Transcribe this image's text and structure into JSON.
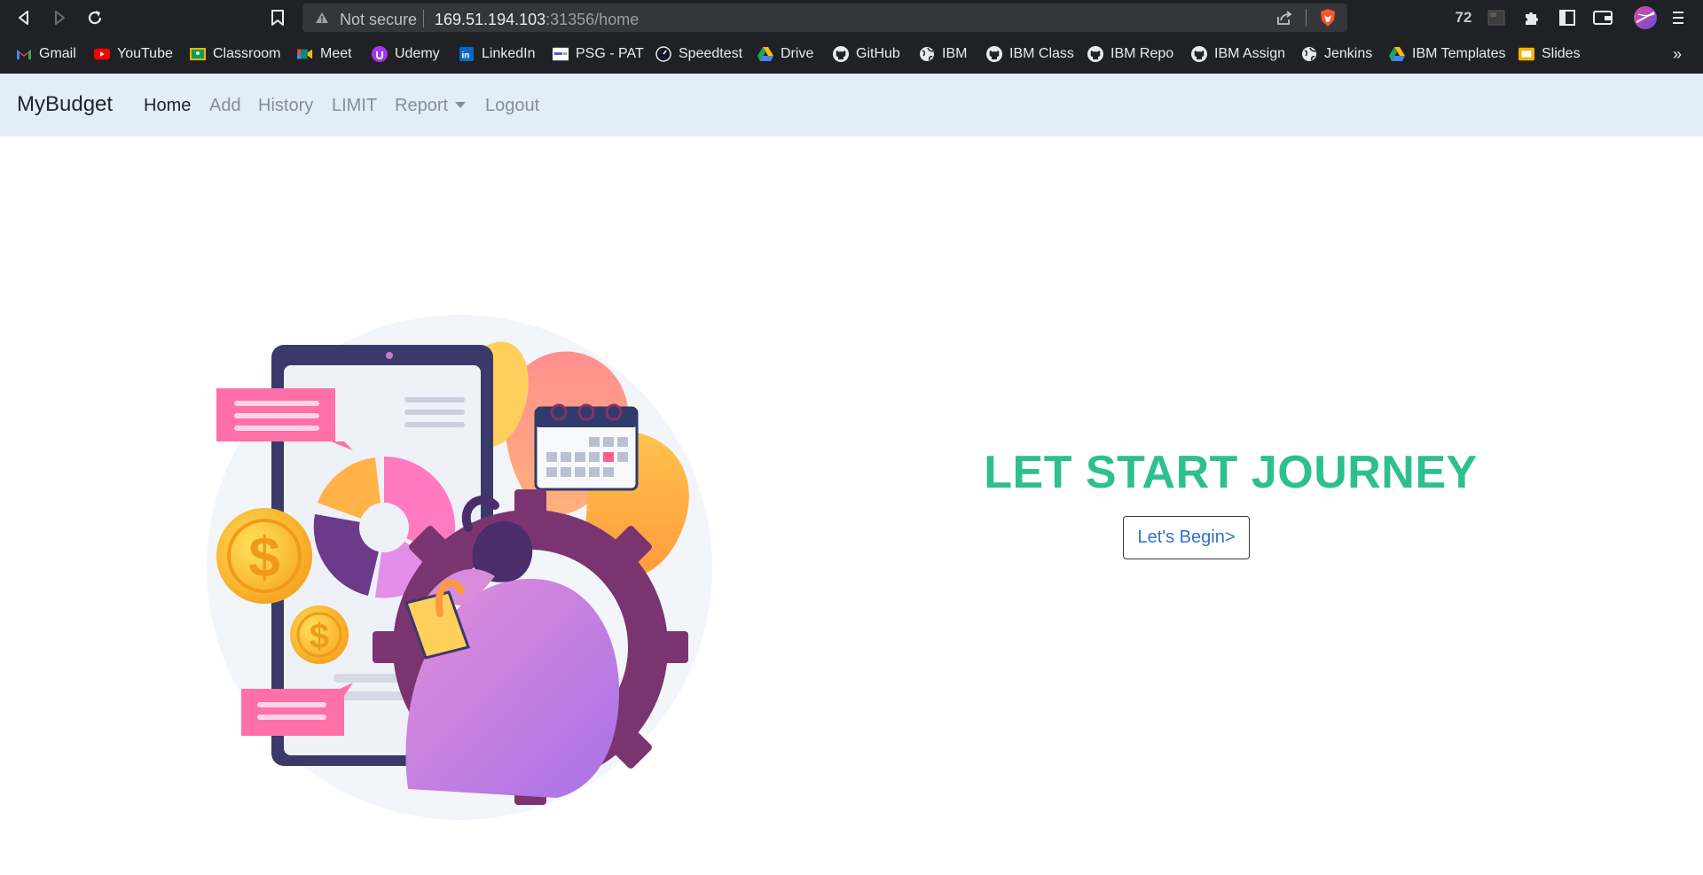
{
  "browser": {
    "security_label": "Not secure",
    "url_host": "169.51.194.103",
    "url_rest": ":31356/home",
    "ext_badge": "72",
    "more_bookmarks": "»",
    "bookmarks": [
      {
        "label": "Gmail",
        "icon": "gmail-icon",
        "color": "#ea4335"
      },
      {
        "label": "YouTube",
        "icon": "youtube-icon",
        "color": "#ff0000"
      },
      {
        "label": "Classroom",
        "icon": "classroom-icon",
        "color": "#f4b400"
      },
      {
        "label": "Meet",
        "icon": "meet-icon",
        "color": "#00897b"
      },
      {
        "label": "Udemy",
        "icon": "udemy-icon",
        "color": "#a435f0"
      },
      {
        "label": "LinkedIn",
        "icon": "linkedin-icon",
        "color": "#0a66c2"
      },
      {
        "label": "PSG - PAT",
        "icon": "psg-icon",
        "color": "#ffffff"
      },
      {
        "label": "Speedtest",
        "icon": "speedtest-icon",
        "color": "#141526"
      },
      {
        "label": "Drive",
        "icon": "drive-icon",
        "color": "#1fa463"
      },
      {
        "label": "GitHub",
        "icon": "github-icon",
        "color": "#e8eaed"
      },
      {
        "label": "IBM",
        "icon": "globe-icon",
        "color": "#e8eaed"
      },
      {
        "label": "IBM Class",
        "icon": "github-icon",
        "color": "#e8eaed"
      },
      {
        "label": "IBM Repo",
        "icon": "github-icon",
        "color": "#e8eaed"
      },
      {
        "label": "IBM Assign",
        "icon": "github-icon",
        "color": "#e8eaed"
      },
      {
        "label": "Jenkins",
        "icon": "globe-icon",
        "color": "#e8eaed"
      },
      {
        "label": "IBM Templates",
        "icon": "drive-icon",
        "color": "#1fa463"
      },
      {
        "label": "Slides",
        "icon": "slides-icon",
        "color": "#f4b400"
      }
    ]
  },
  "navbar": {
    "brand": "MyBudget",
    "links": {
      "home": "Home",
      "add": "Add",
      "history": "History",
      "limit": "LIMIT",
      "report": "Report",
      "logout": "Logout"
    }
  },
  "hero": {
    "title": "LET START JOURNEY",
    "button": "Let's Begin>"
  },
  "colors": {
    "navbar_bg": "#e1eef9",
    "title": "#2ebf91",
    "button_text": "#2f73c4"
  }
}
